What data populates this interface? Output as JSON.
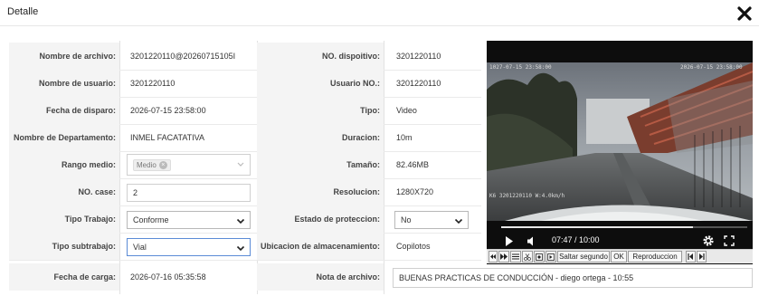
{
  "dialog": {
    "title": "Detalle",
    "close_icon": "close-icon"
  },
  "fields": {
    "nombre_archivo": {
      "label": "Nombre de archivo:",
      "value": "3201220110@20260715105I"
    },
    "no_dispositivo": {
      "label": "NO. dispoitivo:",
      "value": "3201220110"
    },
    "nombre_usuario": {
      "label": "Nombre de usuario:",
      "value": "3201220110"
    },
    "usuario_no": {
      "label": "Usuario NO.:",
      "value": "3201220110"
    },
    "fecha_disparo": {
      "label": "Fecha de disparo:",
      "value": "2026-07-15 23:58:00"
    },
    "tipo": {
      "label": "Tipo:",
      "value": "Video"
    },
    "departamento": {
      "label": "Nombre de Departamento:",
      "value": "INMEL FACATATIVA"
    },
    "duracion": {
      "label": "Duracion:",
      "value": "10m"
    },
    "rango_medio": {
      "label": "Rango medio:",
      "tag": "Medio"
    },
    "tamano": {
      "label": "Tamaño:",
      "value": "82.46MB"
    },
    "no_case": {
      "label": "NO. case:",
      "value": "2"
    },
    "resolucion": {
      "label": "Resolucion:",
      "value": "1280X720"
    },
    "tipo_trabajo": {
      "label": "Tipo Trabajo:",
      "value": "Conforme"
    },
    "estado_proteccion": {
      "label": "Estado de proteccion:",
      "value": "No"
    },
    "tipo_subtrabajo": {
      "label": "Tipo subtrabajo:",
      "value": "Vial"
    },
    "ubicacion": {
      "label": "Ubicacion de almacenamiento:",
      "value": "Copilotos"
    },
    "fecha_carga": {
      "label": "Fecha de carga:",
      "value": "2026-07-16 05:35:58"
    },
    "nota_archivo": {
      "label": "Nota de archivo:",
      "value": "BUENAS PRACTICAS DE CONDUCCIÓN - diego ortega - 10:55"
    }
  },
  "video": {
    "overlay_top_left": "1027-07-15 23:58:00",
    "overlay_top_right": "2026-07-15 23:58:00",
    "overlay_bottom_left": "K6 3201220110 W:4.0km/h",
    "time": "07:47 / 10:00",
    "progress_fraction": 0.778
  },
  "toolbar": {
    "saltar_label": "Saltar segundo",
    "ok_label": "OK",
    "reproduccion_label": "Reproduccion"
  }
}
